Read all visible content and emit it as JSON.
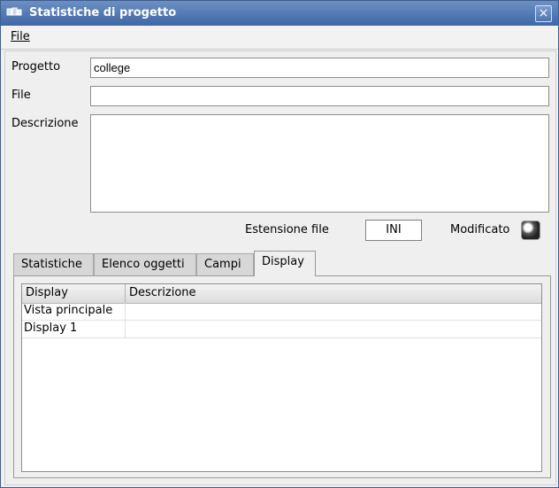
{
  "window": {
    "title": "Statistiche di progetto",
    "close_label": "×"
  },
  "menu": {
    "file": "File"
  },
  "form": {
    "progetto_label": "Progetto",
    "progetto_value": "college",
    "file_label": "File",
    "file_value": "",
    "descrizione_label": "Descrizione",
    "descrizione_value": "",
    "estensione_label": "Estensione file",
    "estensione_value": "INI",
    "modificato_label": "Modificato"
  },
  "tabs": [
    {
      "label": "Statistiche"
    },
    {
      "label": "Elenco oggetti"
    },
    {
      "label": "Campi"
    },
    {
      "label": "Display"
    }
  ],
  "table": {
    "headers": [
      "Display",
      "Descrizione"
    ],
    "rows": [
      [
        "Vista principale",
        ""
      ],
      [
        "Display 1",
        ""
      ]
    ]
  }
}
